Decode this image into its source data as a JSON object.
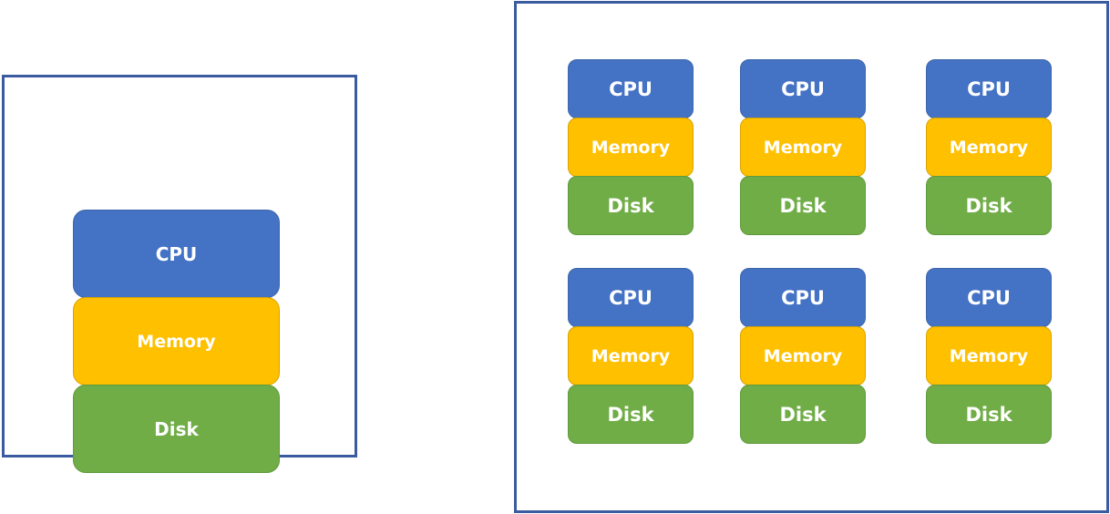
{
  "colors": {
    "frame_border": "#3a5b9f",
    "cpu": "#4472c4",
    "memory": "#ffc000",
    "disk": "#70ad47",
    "label_text": "#ffffff"
  },
  "single_machine": {
    "components": [
      "CPU",
      "Memory",
      "Disk"
    ]
  },
  "cluster": {
    "rows": 2,
    "columns": 3,
    "machines": [
      {
        "components": [
          "CPU",
          "Memory",
          "Disk"
        ]
      },
      {
        "components": [
          "CPU",
          "Memory",
          "Disk"
        ]
      },
      {
        "components": [
          "CPU",
          "Memory",
          "Disk"
        ]
      },
      {
        "components": [
          "CPU",
          "Memory",
          "Disk"
        ]
      },
      {
        "components": [
          "CPU",
          "Memory",
          "Disk"
        ]
      },
      {
        "components": [
          "CPU",
          "Memory",
          "Disk"
        ]
      }
    ]
  }
}
